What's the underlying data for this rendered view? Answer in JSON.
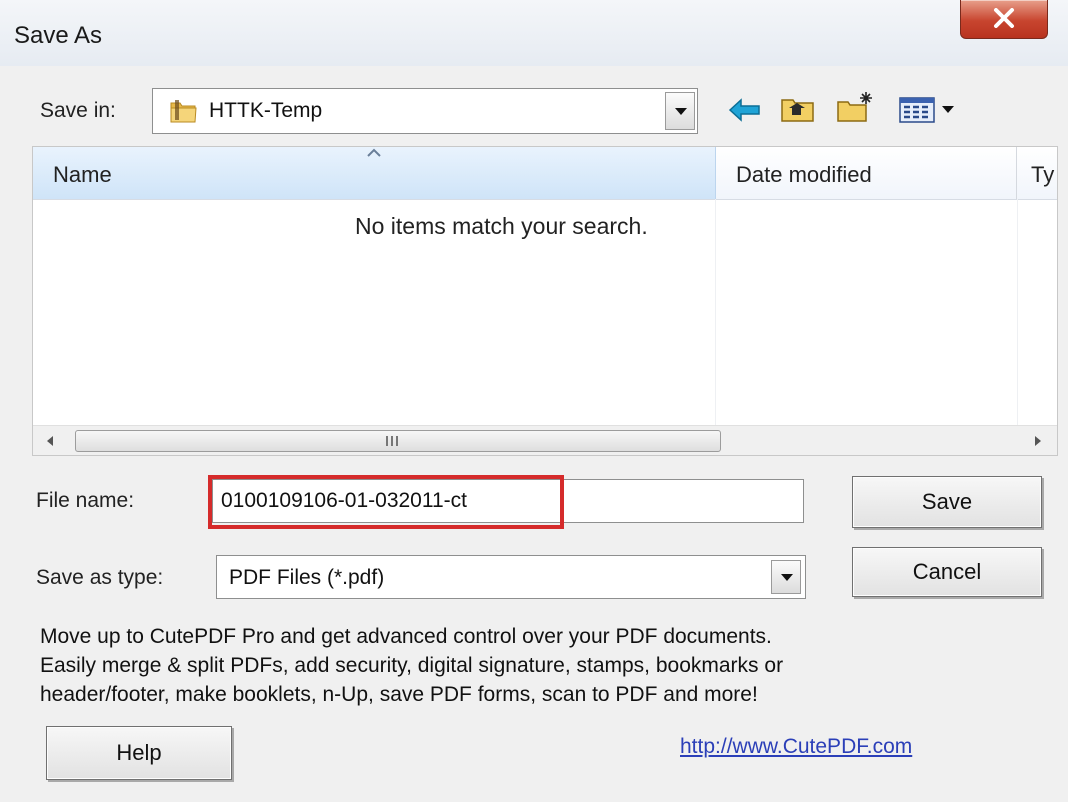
{
  "window": {
    "title": "Save As",
    "close_glyph": "X"
  },
  "save_in": {
    "label": "Save in:",
    "value": "HTTK-Temp",
    "icons": [
      "folder-icon",
      "back-arrow-icon",
      "up-folder-icon",
      "new-folder-icon",
      "view-menu-icon"
    ]
  },
  "file_list": {
    "columns": [
      "Name",
      "Date modified",
      "Ty"
    ],
    "empty_message": "No items match your search.",
    "scroll_grip": "III"
  },
  "file_name": {
    "label": "File name:",
    "value": "0100109106-01-032011-ct"
  },
  "save_as_type": {
    "label": "Save as type:",
    "value": "PDF Files (*.pdf)"
  },
  "buttons": {
    "save": "Save",
    "cancel": "Cancel",
    "help": "Help"
  },
  "promo": {
    "lines": [
      "Move up to CutePDF Pro and get advanced control over your PDF documents.",
      "Easily merge & split PDFs, add security, digital signature, stamps, bookmarks or",
      "header/footer, make booklets, n-Up, save PDF forms, scan to PDF and more!"
    ],
    "link": "http://www.CutePDF.com"
  },
  "colors": {
    "highlight": "#d52b2b",
    "link": "#2b3fb8",
    "close_button": "#c8452f",
    "arrow_icon": "#1fa3d6"
  }
}
